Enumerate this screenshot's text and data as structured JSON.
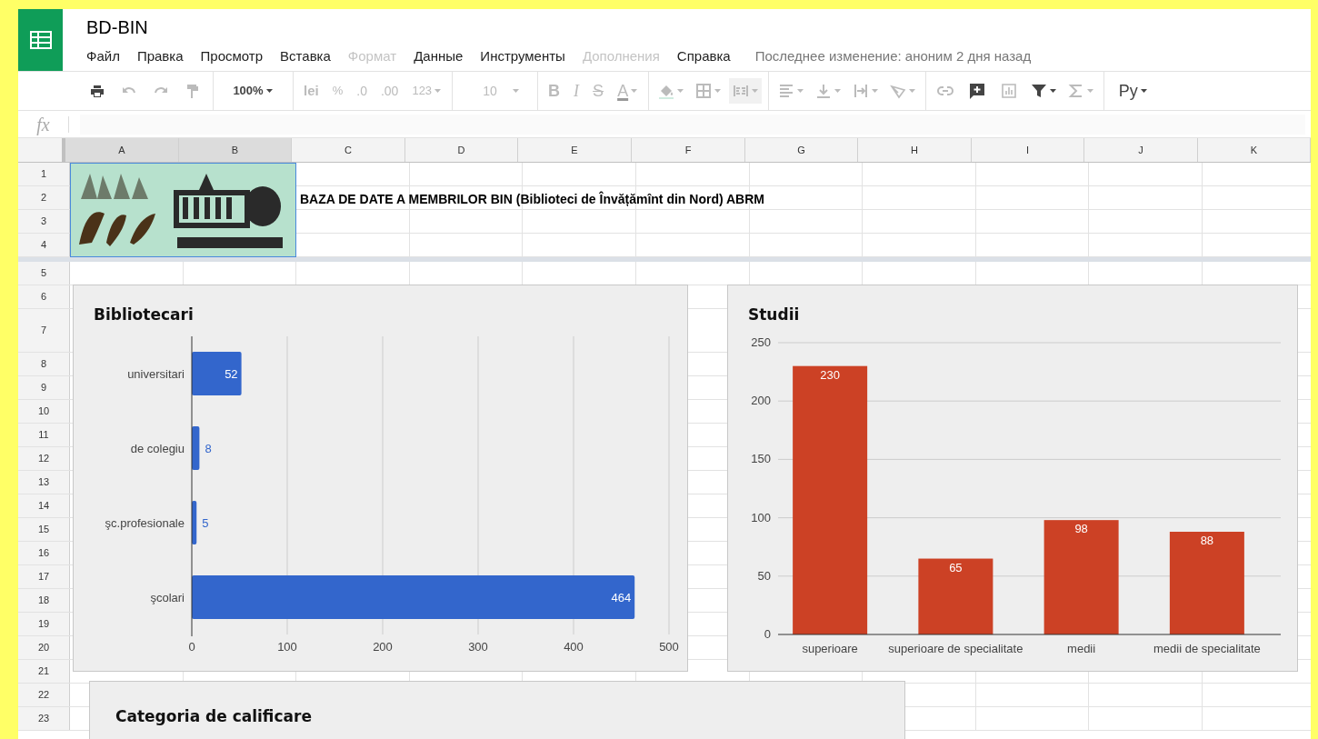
{
  "app": {
    "title": "BD-BIN"
  },
  "menu": [
    {
      "label": "Файл",
      "disabled": false
    },
    {
      "label": "Правка",
      "disabled": false
    },
    {
      "label": "Просмотр",
      "disabled": false
    },
    {
      "label": "Вставка",
      "disabled": false
    },
    {
      "label": "Формат",
      "disabled": true
    },
    {
      "label": "Данные",
      "disabled": false
    },
    {
      "label": "Инструменты",
      "disabled": false
    },
    {
      "label": "Дополнения",
      "disabled": true
    },
    {
      "label": "Справка",
      "disabled": false
    }
  ],
  "last_edit": "Последнее изменение: аноним 2 дня назад",
  "toolbar": {
    "zoom": {
      "text": "100%",
      "disabled": false
    },
    "currency": {
      "text": "lei",
      "disabled": true
    },
    "percent": {
      "text": "%",
      "disabled": true
    },
    "decimal_less": {
      "text": ".0",
      "disabled": true
    },
    "decimal_more": {
      "text": ".00",
      "disabled": true
    },
    "number_format": {
      "text": "123",
      "disabled": true
    },
    "font_size": {
      "text": "10",
      "disabled": true
    },
    "bold": {
      "text": "B",
      "disabled": true
    },
    "italic": {
      "text": "I",
      "disabled": true
    },
    "strike": {
      "text": "S",
      "disabled": true
    },
    "text_color": {
      "text": "A",
      "disabled": true
    },
    "input_tools": {
      "text": "Ру",
      "disabled": false
    }
  },
  "formula_bar": {
    "label": "fx"
  },
  "columns": [
    {
      "label": "A",
      "selected": true
    },
    {
      "label": "B",
      "selected": true
    },
    {
      "label": "C",
      "selected": false
    },
    {
      "label": "D",
      "selected": false
    },
    {
      "label": "E",
      "selected": false
    },
    {
      "label": "F",
      "selected": false
    },
    {
      "label": "G",
      "selected": false
    },
    {
      "label": "H",
      "selected": false
    },
    {
      "label": "I",
      "selected": false
    },
    {
      "label": "J",
      "selected": false
    },
    {
      "label": "K",
      "selected": false
    }
  ],
  "rows": [
    "1",
    "2",
    "3",
    "4",
    "5",
    "6",
    "7",
    "8",
    "9",
    "10",
    "11",
    "12",
    "13",
    "14",
    "15",
    "16",
    "17",
    "18",
    "19",
    "20",
    "21",
    "22",
    "23"
  ],
  "cell_c2": "BAZA DE DATE A MEMBRILOR BIN (Biblioteci de Învățămînt din Nord) ABRM",
  "charts": [
    {
      "chart_data": {
        "type": "bar",
        "orientation": "horizontal",
        "title": "Bibliotecari",
        "categories": [
          "universitari",
          "de colegiu",
          "şc.profesionale",
          "şcolari"
        ],
        "series": [
          {
            "color": "#3366cc",
            "values": [
              52,
              8,
              5,
              464
            ]
          }
        ],
        "grid": true,
        "xlim": [
          0,
          500
        ],
        "xticks": [
          0,
          100,
          200,
          300,
          400,
          500
        ],
        "data_labels": true
      }
    },
    {
      "chart_data": {
        "type": "bar",
        "orientation": "vertical",
        "title": "Studii",
        "categories": [
          "superioare",
          "superioare de specialitate",
          "medii",
          "medii de specialitate"
        ],
        "series": [
          {
            "color": "#cc4125",
            "values": [
              230,
              65,
              98,
              88
            ]
          }
        ],
        "grid": true,
        "ylim": [
          0,
          250
        ],
        "yticks": [
          0,
          50,
          100,
          150,
          200,
          250
        ],
        "data_labels": true
      }
    },
    {
      "title": "Categoria de calificare"
    }
  ]
}
